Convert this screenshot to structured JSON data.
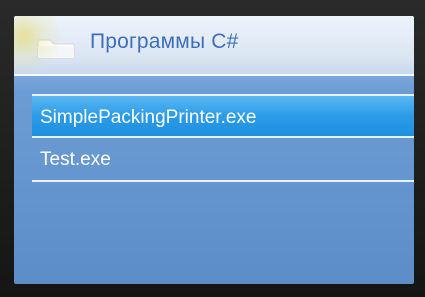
{
  "window": {
    "title": "Программы C#",
    "icon": "folder-icon"
  },
  "programs": [
    {
      "label": "SimplePackingPrinter.exe",
      "selected": true
    },
    {
      "label": "Test.exe",
      "selected": false
    }
  ],
  "colors": {
    "title_text": "#3f6fb8",
    "selection": "#2c9be8",
    "background": "#6a9ad2"
  }
}
